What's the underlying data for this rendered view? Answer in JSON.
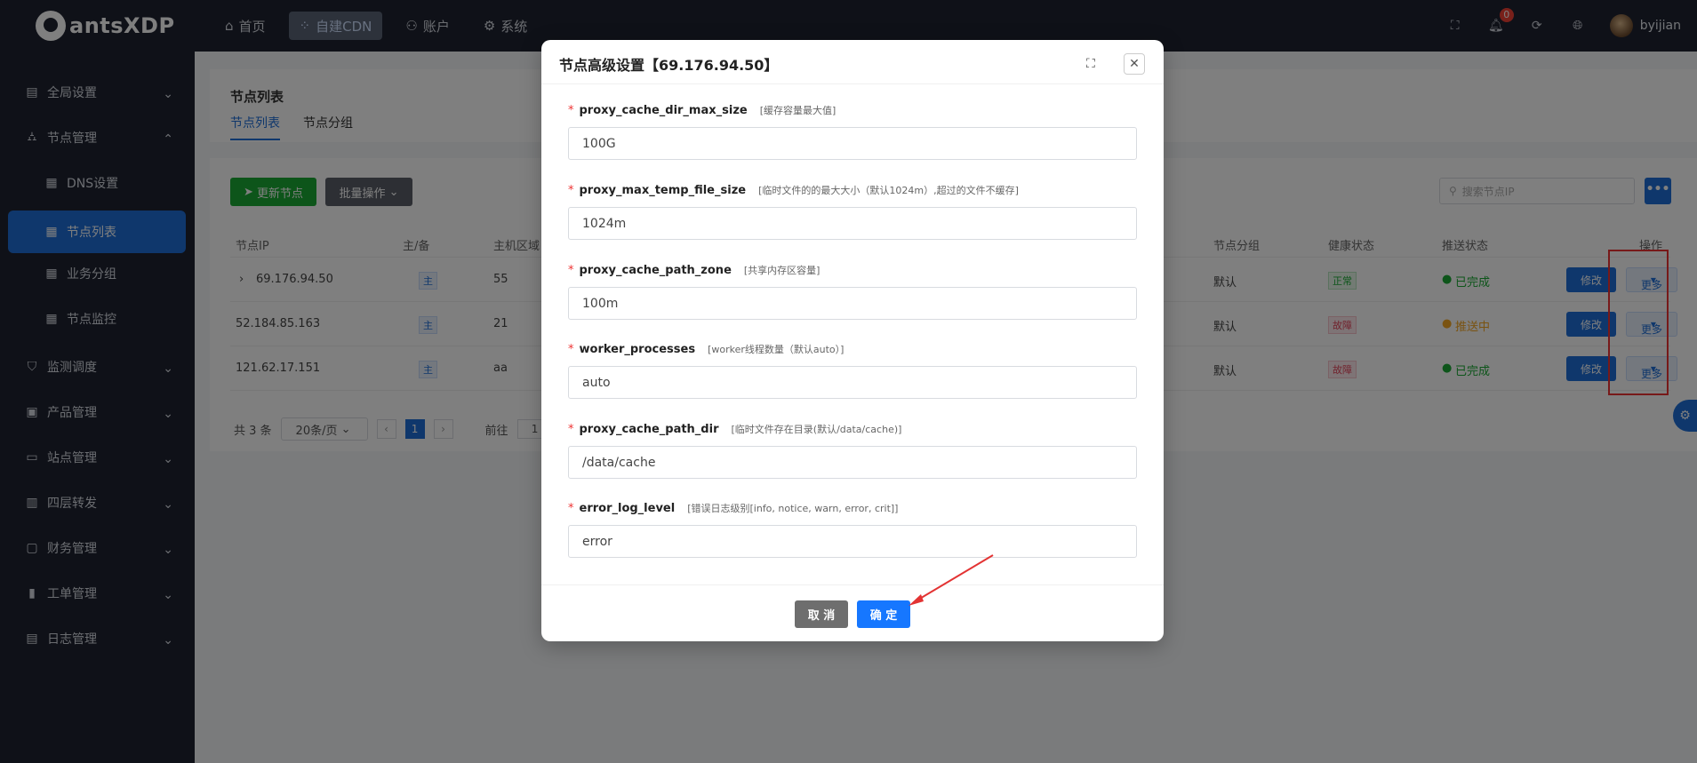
{
  "brand": {
    "name": "antsXDP"
  },
  "topnav": [
    {
      "label": "首页",
      "icon": "home-icon"
    },
    {
      "label": "自建CDN",
      "icon": "cdn-icon"
    },
    {
      "label": "账户",
      "icon": "user-icon"
    },
    {
      "label": "系统",
      "icon": "gear-icon"
    }
  ],
  "topright": {
    "notifications": "0",
    "username": "byijian"
  },
  "sidebar": {
    "items": [
      {
        "label": "全局设置"
      },
      {
        "label": "节点管理"
      },
      {
        "label": "DNS设置"
      },
      {
        "label": "节点列表"
      },
      {
        "label": "业务分组"
      },
      {
        "label": "节点监控"
      },
      {
        "label": "监测调度"
      },
      {
        "label": "产品管理"
      },
      {
        "label": "站点管理"
      },
      {
        "label": "四层转发"
      },
      {
        "label": "财务管理"
      },
      {
        "label": "工单管理"
      },
      {
        "label": "日志管理"
      }
    ]
  },
  "page": {
    "title": "节点列表",
    "tabs": [
      "节点列表",
      "节点分组"
    ],
    "update_btn": "更新节点",
    "batch_btn": "批量操作",
    "search_placeholder": "搜索节点IP",
    "more_sq": "•••",
    "columns": {
      "ip": "节点IP",
      "role": "主/备",
      "region": "主机区域",
      "group": "节点分组",
      "health": "健康状态",
      "push": "推送状态",
      "ops": "操作"
    },
    "rows": [
      {
        "ip": "69.176.94.50",
        "role": "主",
        "region": "55",
        "group": "默认",
        "health": "正常",
        "push": "已完成"
      },
      {
        "ip": "52.184.85.163",
        "role": "主",
        "region": "21",
        "group": "默认",
        "health": "故障",
        "push": "推送中"
      },
      {
        "ip": "121.62.17.151",
        "role": "主",
        "region": "aa",
        "group": "默认",
        "health": "故障",
        "push": "已完成"
      }
    ],
    "edit_label": "修改",
    "more_label": "更多",
    "pager": {
      "total": "共 3 条",
      "size": "20条/页",
      "current": "1",
      "goto": "前往",
      "goto_val": "1"
    }
  },
  "modal": {
    "title": "节点高级设置【69.176.94.50】",
    "fields": [
      {
        "label": "proxy_cache_dir_max_size",
        "hint": "[缓存容量最大值]",
        "value": "100G"
      },
      {
        "label": "proxy_max_temp_file_size",
        "hint": "[临时文件的的最大大小（默认1024m）,超过的文件不缓存]",
        "value": "1024m"
      },
      {
        "label": "proxy_cache_path_zone",
        "hint": "[共享内存区容量]",
        "value": "100m"
      },
      {
        "label": "worker_processes",
        "hint": "[worker线程数量（默认auto）]",
        "value": "auto"
      },
      {
        "label": "proxy_cache_path_dir",
        "hint": "[临时文件存在目录(默认/data/cache)]",
        "value": "/data/cache"
      },
      {
        "label": "error_log_level",
        "hint": "[错误日志级别[info, notice, warn, error, crit]]",
        "value": "error"
      }
    ],
    "cancel": "取 消",
    "ok": "确 定"
  },
  "colors": {
    "primary": "#1f6fd8",
    "ok_button": "#1677ff",
    "annotation": "#e33333"
  }
}
